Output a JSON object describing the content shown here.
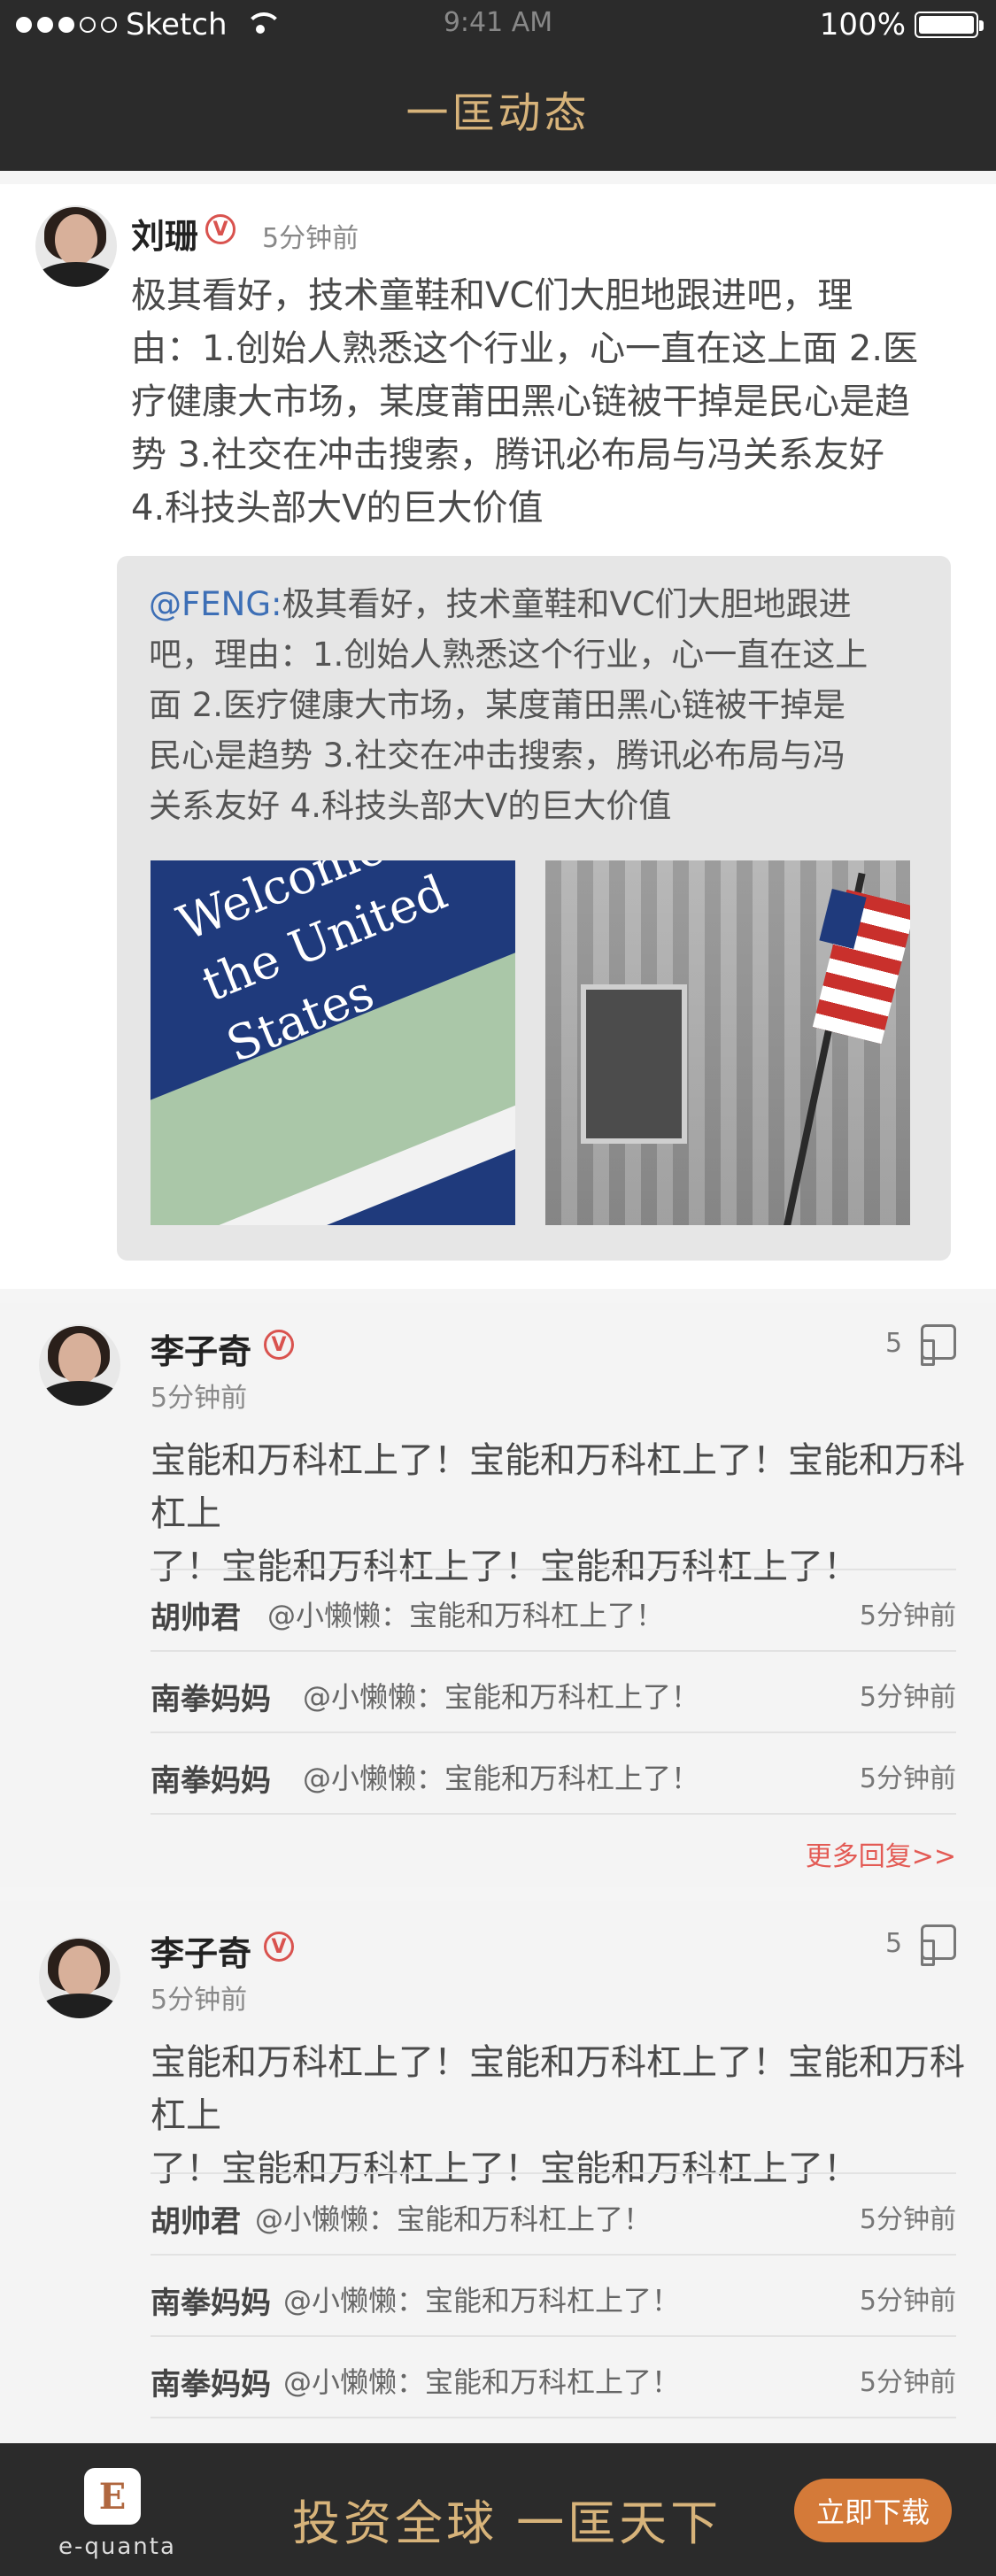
{
  "status_bar": {
    "carrier": "Sketch",
    "time": "9:41 AM",
    "battery": "100%"
  },
  "header": {
    "title": "一匡动态"
  },
  "post": {
    "author": "刘珊",
    "time": "5分钟前",
    "content_lines": [
      "极其看好，技术童鞋和VC们大胆地跟进吧，理",
      "由：1.创始人熟悉这个行业，心一直在这上面 2.医",
      "疗健康大市场，某度莆田黑心链被干掉是民心是趋",
      "势 3.社交在冲击搜索，腾讯必布局与冯关系友好",
      "4.科技头部大V的巨大价值"
    ],
    "quote": {
      "mention": "@FENG:",
      "lines": [
        "极其看好，技术童鞋和VC们大胆地跟进",
        "吧，理由：1.创始人熟悉这个行业，心一直在这上",
        "面 2.医疗健康大市场，某度莆田黑心链被干掉是",
        "民心是趋势 3.社交在冲击搜索，腾讯必布局与冯",
        "关系友好 4.科技头部大V的巨大价值"
      ],
      "image1_text": "Welcome to the United States",
      "image2_alt": "building-with-flag"
    }
  },
  "comments": [
    {
      "author": "李子奇",
      "time": "5分钟前",
      "likes": "5",
      "content_lines": [
        "宝能和万科杠上了！宝能和万科杠上了！宝能和万科杠上",
        "了！宝能和万科杠上了！宝能和万科杠上了！"
      ],
      "replies": [
        {
          "name": "胡帅君",
          "text": "@小懒懒：宝能和万科杠上了！",
          "time": "5分钟前"
        },
        {
          "name": "南拳妈妈",
          "text": "@小懒懒：宝能和万科杠上了！",
          "time": "5分钟前"
        },
        {
          "name": "南拳妈妈",
          "text": "@小懒懒：宝能和万科杠上了！",
          "time": "5分钟前"
        }
      ],
      "more": "更多回复>>"
    },
    {
      "author": "李子奇",
      "time": "5分钟前",
      "likes": "5",
      "content_lines": [
        "宝能和万科杠上了！宝能和万科杠上了！宝能和万科杠上",
        "了！宝能和万科杠上了！宝能和万科杠上了！"
      ],
      "replies": [
        {
          "name": "胡帅君",
          "text": "@小懒懒：宝能和万科杠上了！",
          "time": "5分钟前"
        },
        {
          "name": "南拳妈妈",
          "text": "@小懒懒：宝能和万科杠上了！",
          "time": "5分钟前"
        },
        {
          "name": "南拳妈妈",
          "text": "@小懒懒：宝能和万科杠上了！",
          "time": "5分钟前"
        }
      ]
    }
  ],
  "banner": {
    "logo_text": "e-quanta",
    "slogan": "投资全球 一匡天下",
    "download": "立即下载"
  },
  "colors": {
    "header_bg": "#2b2b2b",
    "gold": "#d7b37a",
    "mention": "#3d6fb6",
    "accent_red": "#e35b55",
    "download_orange": "#d47a39"
  },
  "icons": {
    "verified": "verified-badge-icon",
    "thumb": "thumbs-up-icon",
    "wifi": "wifi-icon",
    "battery": "battery-icon"
  }
}
